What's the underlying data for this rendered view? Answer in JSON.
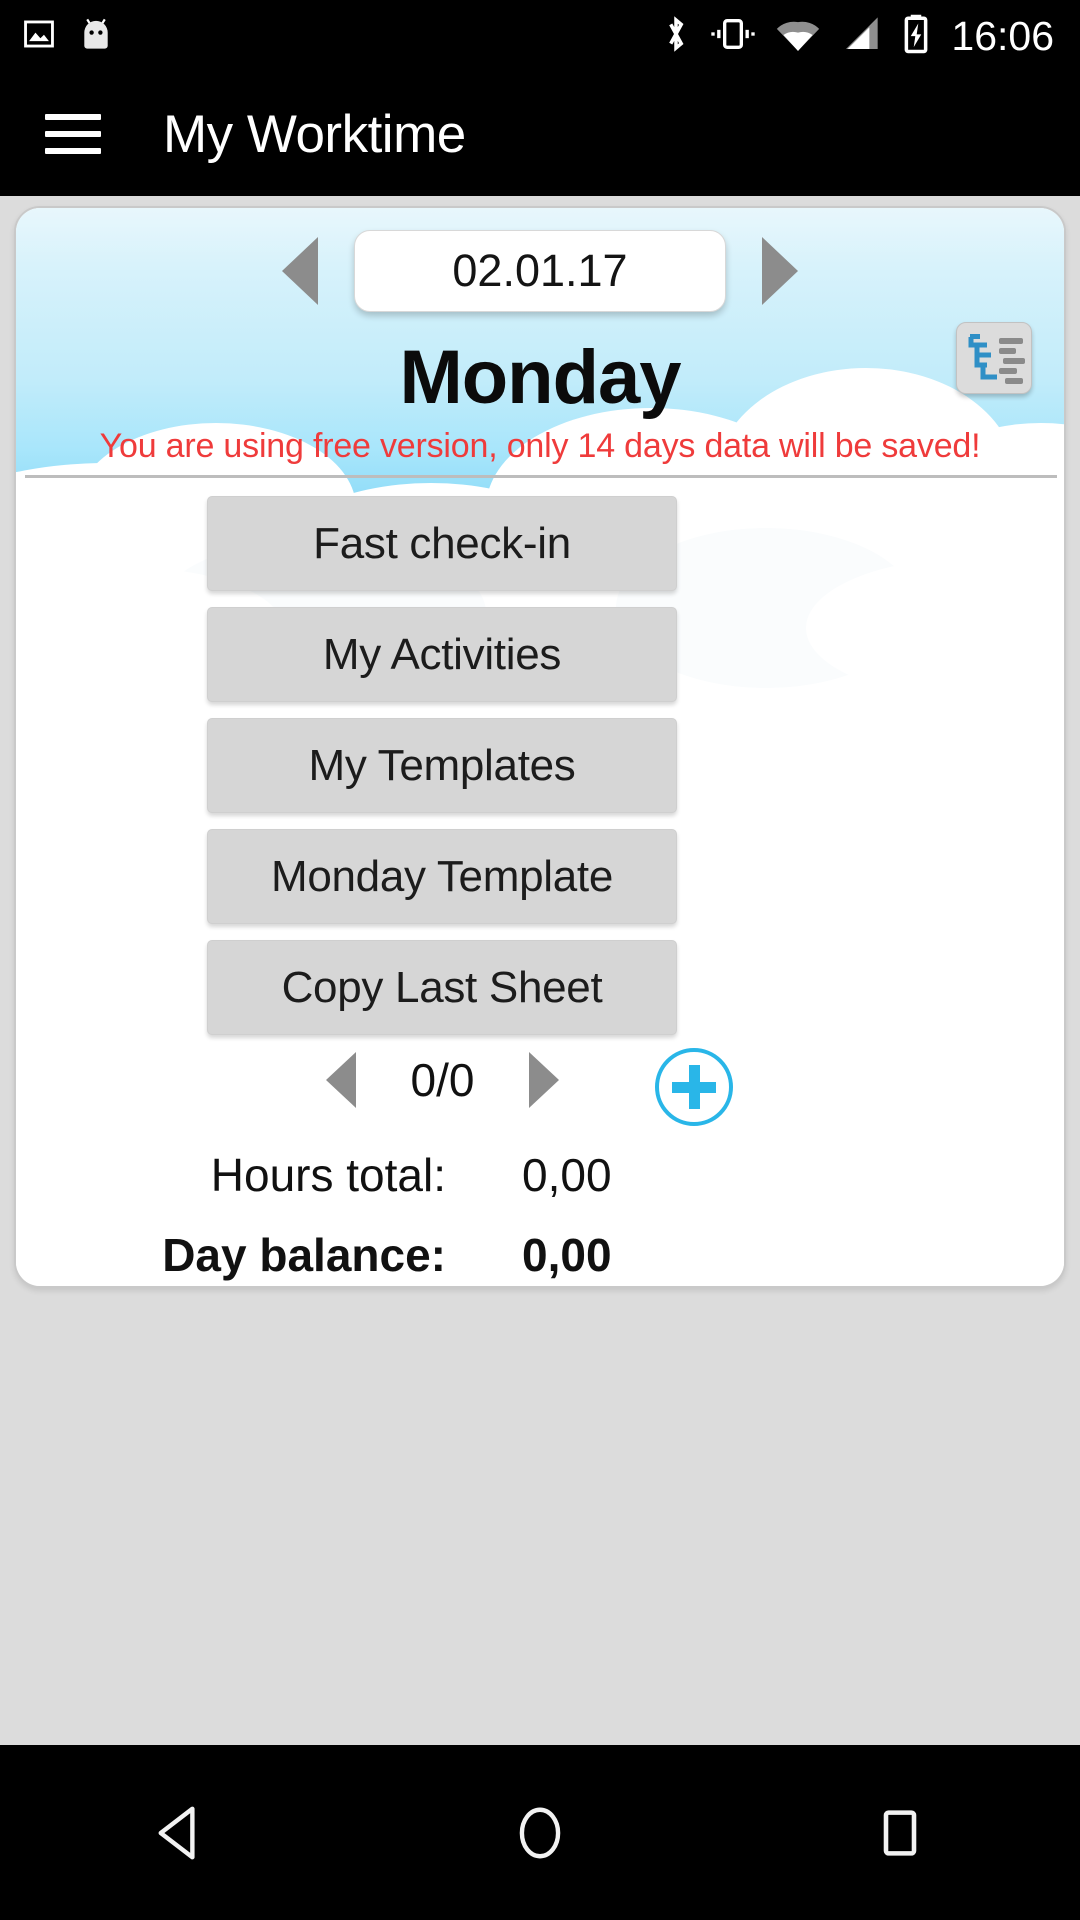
{
  "status_bar": {
    "left_icons": [
      "screenshot-image-icon",
      "android-mascot-icon"
    ],
    "right_icons": [
      "bluetooth-icon",
      "vibrate-icon",
      "wifi-icon",
      "cellular-signal-icon",
      "battery-charging-icon"
    ],
    "time": "16:06"
  },
  "app_bar": {
    "menu_icon": "hamburger-menu-icon",
    "title": "My Worktime"
  },
  "date_nav": {
    "prev_icon": "previous-day-arrow-icon",
    "next_icon": "next-day-arrow-icon",
    "date": "02.01.17"
  },
  "day": {
    "name": "Monday",
    "report_icon": "activity-report-icon"
  },
  "notice": {
    "text": "You are using free version, only 14 days data will be saved!",
    "color": "#ef3b3b"
  },
  "actions": [
    {
      "label": "Fast check-in"
    },
    {
      "label": "My Activities"
    },
    {
      "label": "My Templates"
    },
    {
      "label": "Monday Template"
    },
    {
      "label": "Copy Last Sheet"
    }
  ],
  "pager": {
    "prev_icon": "previous-entry-arrow-icon",
    "next_icon": "next-entry-arrow-icon",
    "count": "0/0",
    "add_icon": "add-entry-plus-icon",
    "accent_color": "#29b6e8"
  },
  "summary": [
    {
      "label": "Hours total:",
      "value": "0,00"
    },
    {
      "label": "Day balance:",
      "value": "0,00"
    }
  ],
  "nav_bar": {
    "back_icon": "back-triangle-icon",
    "home_icon": "home-circle-icon",
    "recents_icon": "recents-square-icon"
  }
}
